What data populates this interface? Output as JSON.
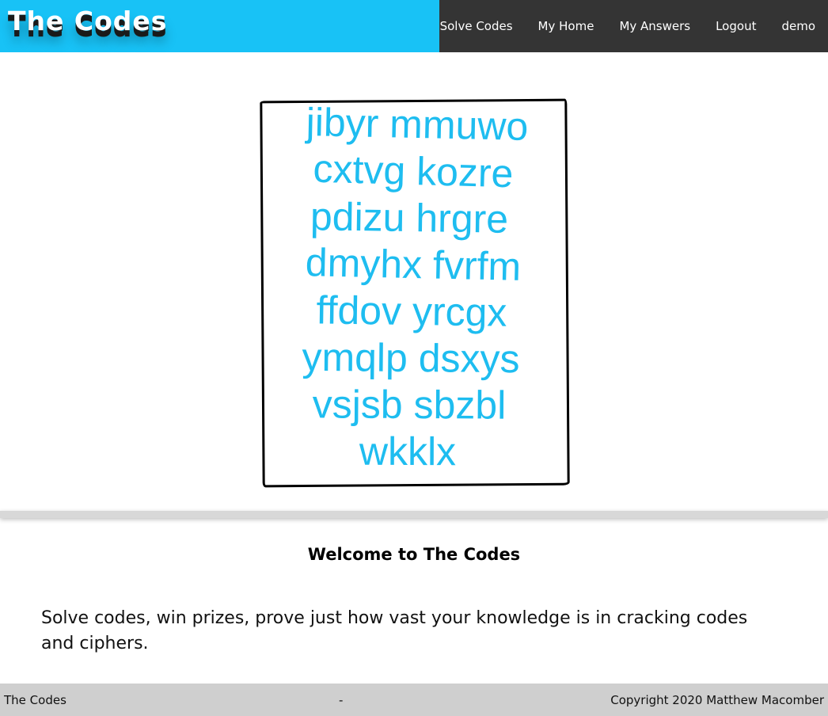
{
  "header": {
    "logo_text": "The Codes",
    "brand_color": "#18c2f6",
    "nav_bg_color": "#343434",
    "nav": [
      {
        "label": "Solve Codes"
      },
      {
        "label": "My Home"
      },
      {
        "label": "My Answers"
      },
      {
        "label": "Logout"
      },
      {
        "label": "demo"
      }
    ]
  },
  "cipher": {
    "text_color": "#1ebdf0",
    "lines": [
      "jibyr mmuwo",
      "cxtvg kozre",
      "pdizu hrgre",
      "dmyhx fvrfm",
      "ffdov yrcgx",
      "ymqlp dsxys",
      "vsjsb sbzbl",
      "wkklx"
    ]
  },
  "welcome": {
    "title": "Welcome to The Codes",
    "text": "Solve codes, win prizes, prove just how vast your knowledge is in cracking codes and ciphers."
  },
  "footer": {
    "left": "The Codes",
    "middle": "-",
    "right": "Copyright 2020 Matthew Macomber"
  }
}
